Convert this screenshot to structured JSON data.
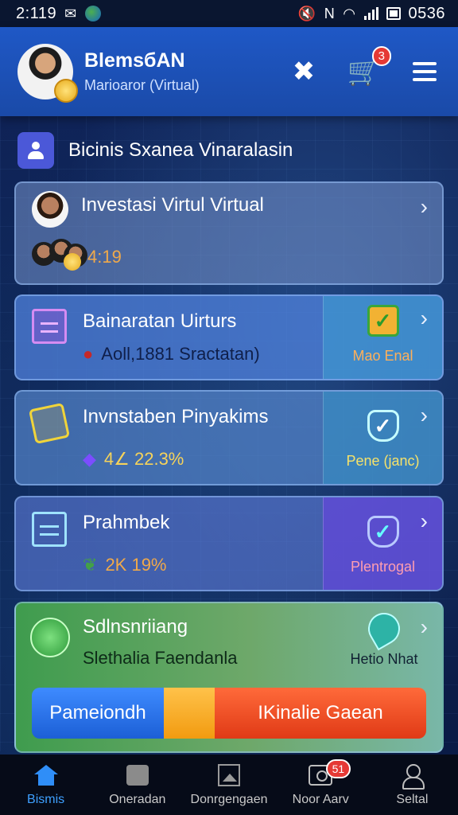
{
  "status_bar": {
    "time": "2:119",
    "right_text": "0536",
    "icons": [
      "mail-icon",
      "globe-icon",
      "mute-icon",
      "nfc-icon",
      "wifi-icon",
      "signal-icon",
      "battery-icon"
    ]
  },
  "header": {
    "user_name": "BlemsбAN",
    "user_role": "Marioaror (Virtual)",
    "cart_badge": "3",
    "icons": [
      "puzzle-icon",
      "cart-icon",
      "menu-icon"
    ]
  },
  "section": {
    "title": "Bicinis Sxanea Vinaralasin"
  },
  "cards": [
    {
      "title": "Investasi Virtul Virtual",
      "value": "4:19",
      "value_color": "#f0a94a"
    },
    {
      "title": "Bainaratan Uirturs",
      "value": "Aoll,1881 Sractatan)",
      "value_color": "#0f1f4a",
      "side_label": "Mao Enal"
    },
    {
      "title": "Invnstaben Pinyakims",
      "value": "4∠ 22.3%",
      "value_color": "#f6d35a",
      "side_label": "Pene (janc)"
    },
    {
      "title": "Prahmbek",
      "value": "2K 19%",
      "value_color": "#f0a94a",
      "side_label": "Plentrogal"
    },
    {
      "title": "Sdlnsnriiang",
      "subtitle": "Slethalia Faendanla",
      "side_label": "Hetio Nhat",
      "buttons": {
        "left": "Pameiondh",
        "right": "IKinalie Gaean"
      }
    }
  ],
  "bottom_nav": {
    "items": [
      {
        "label": "Bismis",
        "icon": "home-icon",
        "active": true
      },
      {
        "label": "Oneradan",
        "icon": "shop-icon",
        "active": false
      },
      {
        "label": "Donrgengaen",
        "icon": "image-icon",
        "active": false
      },
      {
        "label": "Noor Aarv",
        "icon": "camera-icon",
        "active": false,
        "badge": "51"
      },
      {
        "label": "Seltal",
        "icon": "user-icon",
        "active": false
      }
    ]
  }
}
